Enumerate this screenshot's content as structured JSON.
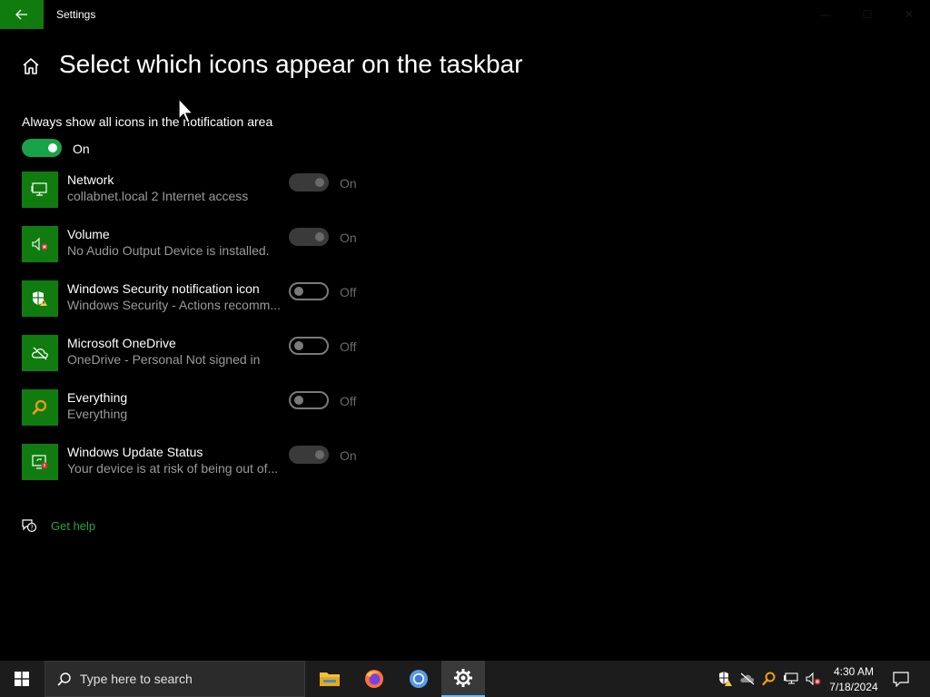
{
  "window": {
    "title": "Settings",
    "back_icon": "arrow-left-icon",
    "controls": [
      "minimize",
      "maximize",
      "close"
    ]
  },
  "page": {
    "title": "Select which icons appear on the taskbar",
    "home_icon": "home-icon"
  },
  "always_show": {
    "label": "Always show all icons in the notification area",
    "state": "On",
    "on": true
  },
  "apps": [
    {
      "name": "Network",
      "description": "collabnet.local 2 Internet access",
      "state": "On",
      "on": true,
      "disabled": true,
      "icon": "network-icon"
    },
    {
      "name": "Volume",
      "description": "No Audio Output Device is installed.",
      "state": "On",
      "on": true,
      "disabled": true,
      "icon": "volume-muted-icon"
    },
    {
      "name": "Windows Security notification icon",
      "description": "Windows Security - Actions recomm...",
      "state": "Off",
      "on": false,
      "disabled": false,
      "icon": "shield-warning-icon"
    },
    {
      "name": "Microsoft OneDrive",
      "description": "OneDrive - Personal Not signed in",
      "state": "Off",
      "on": false,
      "disabled": false,
      "icon": "cloud-off-icon"
    },
    {
      "name": "Everything",
      "description": "Everything",
      "state": "Off",
      "on": false,
      "disabled": false,
      "icon": "magnifier-icon"
    },
    {
      "name": "Windows Update Status",
      "description": "Your device is at risk of being out of...",
      "state": "On",
      "on": true,
      "disabled": true,
      "icon": "update-warning-icon"
    }
  ],
  "help": {
    "label": "Get help",
    "icon": "chat-help-icon"
  },
  "taskbar": {
    "search_placeholder": "Type here to search",
    "apps": [
      "file-explorer-icon",
      "firefox-icon",
      "chrome-icon",
      "settings-gear-icon"
    ],
    "time": "4:30 AM",
    "date": "7/18/2024"
  },
  "colors": {
    "accent": "#107c10",
    "toggle_on": "#16a34a",
    "link": "#2ea043",
    "background": "#000000"
  }
}
